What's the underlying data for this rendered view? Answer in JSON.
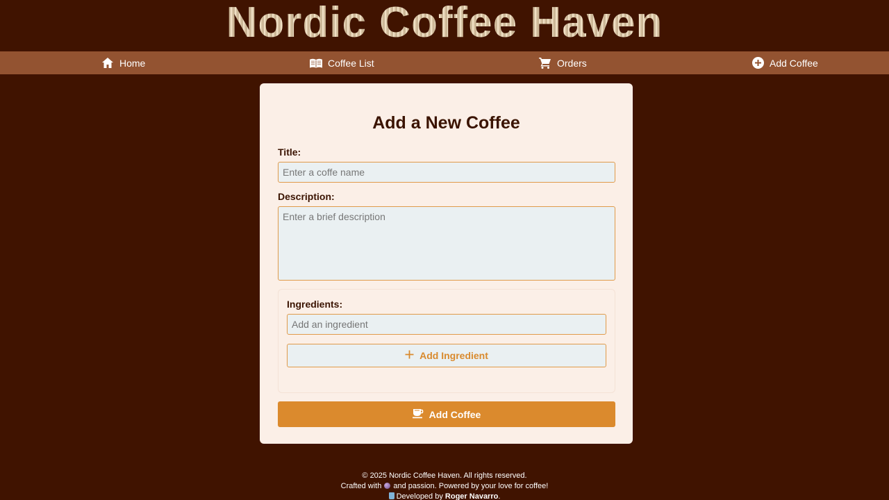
{
  "header": {
    "title": "Nordic Coffee Haven"
  },
  "nav": {
    "items": [
      {
        "label": "Home",
        "icon": "home-icon"
      },
      {
        "label": "Coffee List",
        "icon": "book-icon"
      },
      {
        "label": "Orders",
        "icon": "cart-icon"
      },
      {
        "label": "Add Coffee",
        "icon": "plus-circle-icon"
      }
    ]
  },
  "form": {
    "heading": "Add a New Coffee",
    "title_label": "Title:",
    "title_placeholder": "Enter a coffe name",
    "title_value": "",
    "description_label": "Description:",
    "description_placeholder": "Enter a brief description",
    "description_value": "",
    "ingredients_label": "Ingredients:",
    "ingredient_placeholder": "Add an ingredient",
    "ingredient_value": "",
    "add_ingredient_label": "Add Ingredient",
    "submit_label": "Add Coffee"
  },
  "footer": {
    "copyright": "© 2025 Nordic Coffee Haven. All rights reserved.",
    "crafted_prefix": "Crafted with",
    "crafted_suffix": "and passion. Powered by your love for coffee!",
    "developed_prefix": "Developed by",
    "developer_name": "Roger Navarro",
    "developed_suffix": "."
  },
  "colors": {
    "background": "#401300",
    "navbar": "#935331",
    "card": "#fbefe7",
    "accent": "#db8a2d",
    "input_bg": "#eaf0f2",
    "input_border": "#e09a4a"
  }
}
